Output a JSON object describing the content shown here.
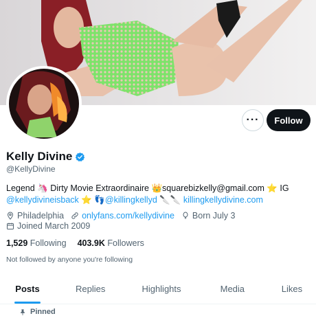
{
  "profile": {
    "display_name": "Kelly Divine",
    "handle": "@KellyDivine",
    "verified_icon": "verified-badge-icon"
  },
  "actions": {
    "more_label": "···",
    "follow_label": "Follow"
  },
  "bio": {
    "part1": "Legend 🦄 Dirty Movie Extraordinaire 👑squarebizkelly@gmail.com ⭐ IG",
    "ig_link": "@kellydivineisback",
    "part2": " ⭐ 👣",
    "mention": "@killingkellyd",
    "part3": " 🔪🔪 ",
    "site_link": "killingkellydivine.com"
  },
  "meta": {
    "location": "Philadelphia",
    "website": "onlyfans.com/kellydivine",
    "birthday": "Born July 3",
    "joined": "Joined March 2009"
  },
  "stats": {
    "following_count": "1,529",
    "following_label": "Following",
    "followers_count": "403.9K",
    "followers_label": "Followers"
  },
  "not_followed": "Not followed by anyone you're following",
  "tabs": [
    {
      "label": "Posts"
    },
    {
      "label": "Replies"
    },
    {
      "label": "Highlights"
    },
    {
      "label": "Media"
    },
    {
      "label": "Likes"
    }
  ],
  "pinned_label": "Pinned",
  "colors": {
    "accent": "#1d9bf0",
    "text_primary": "#0f1419",
    "text_secondary": "#536471",
    "follow_bg": "#0f1419"
  }
}
